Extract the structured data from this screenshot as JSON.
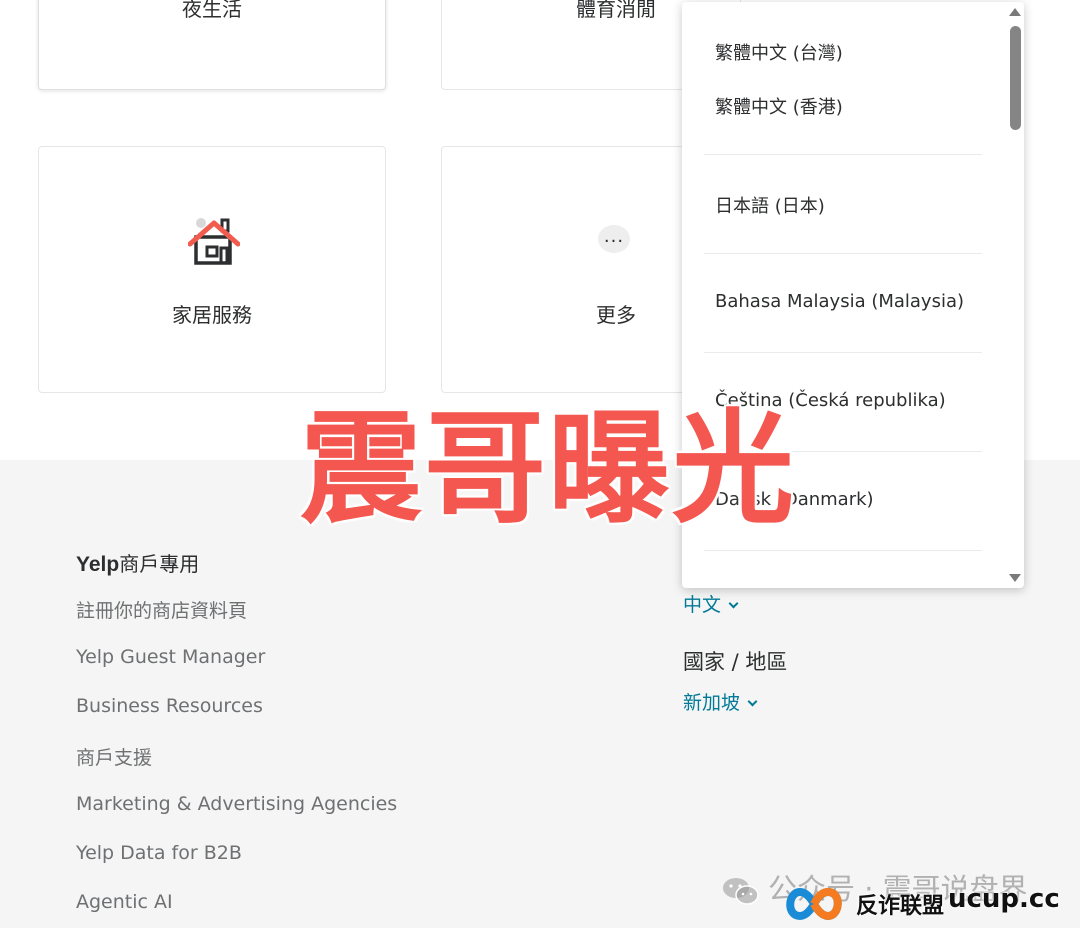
{
  "categories": {
    "nightlife": "夜生活",
    "sports": "體育消閒",
    "home_services": "家居服務",
    "more": "更多",
    "more_icon": "..."
  },
  "language_dropdown": {
    "options": [
      "繁體中文 (台灣)",
      "繁體中文 (香港)",
      "日本語 (日本)",
      "Bahasa Malaysia (Malaysia)",
      "Čeština (Česká republika)",
      "Dansk (Danmark)"
    ]
  },
  "footer": {
    "business_heading_brand": "Yelp",
    "business_heading_rest": "商戶專用",
    "business_links": [
      "註冊你的商店資料頁",
      "Yelp Guest Manager",
      "Business Resources",
      "商戶支援",
      "Marketing & Advertising Agencies",
      "Yelp Data for B2B",
      "Agentic AI"
    ],
    "language_value": "中文",
    "region_heading": "國家 / 地區",
    "region_value": "新加坡"
  },
  "overlay": {
    "title": "震哥曝光"
  },
  "watermarks": {
    "wechat": "公众号 · 震哥说盘界",
    "brand_text": "反诈联盟",
    "brand_domain": "ucup.cc"
  },
  "colors": {
    "link_teal": "#027a97",
    "overlay_red": "#f4574f",
    "house_roof_red": "#f15c4f"
  }
}
